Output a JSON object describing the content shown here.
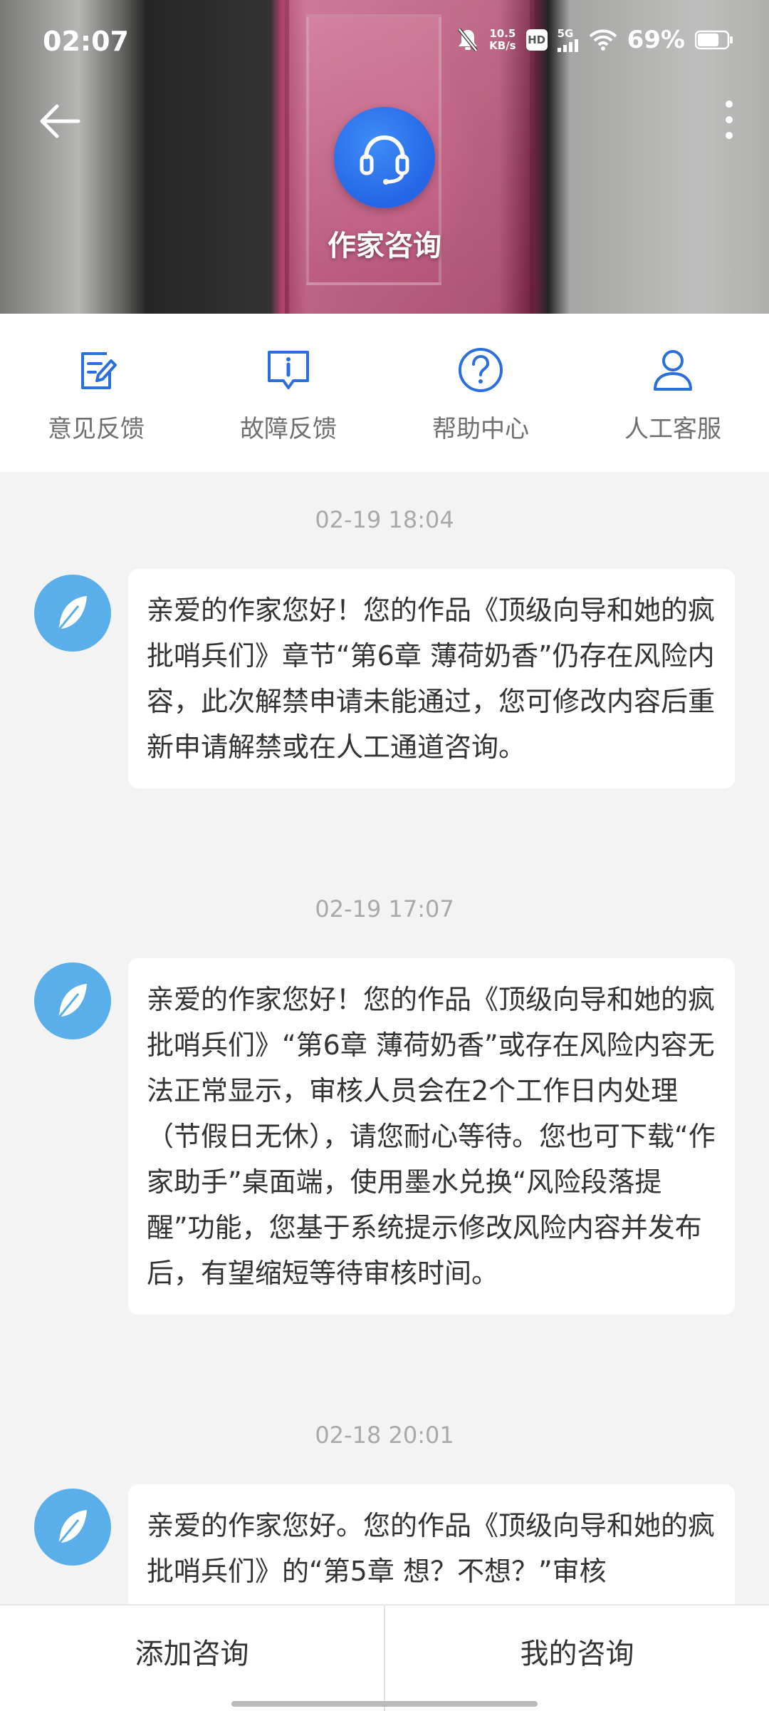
{
  "status_bar": {
    "time": "02:07",
    "net_speed_value": "10.5",
    "net_speed_unit": "KB/s",
    "hd_badge": "HD",
    "network_type": "5G",
    "battery": "69%",
    "icons": [
      "mute-icon",
      "hd-icon",
      "signal-icon",
      "wifi-icon",
      "battery-icon"
    ]
  },
  "header": {
    "title": "作家咨询",
    "logo_icon": "headset-icon",
    "back_icon": "back-arrow-icon",
    "more_icon": "more-vertical-icon",
    "accent_color": "#2466e6"
  },
  "actions": [
    {
      "label": "意见反馈",
      "icon": "feedback-edit-icon"
    },
    {
      "label": "故障反馈",
      "icon": "fault-report-icon"
    },
    {
      "label": "帮助中心",
      "icon": "help-icon"
    },
    {
      "label": "人工客服",
      "icon": "person-icon"
    }
  ],
  "messages": [
    {
      "timestamp": "02-19 18:04",
      "text": "亲爱的作家您好！您的作品《顶级向导和她的疯批哨兵们》章节“第6章 薄荷奶香”仍存在风险内容，此次解禁申请未能通过，您可修改内容后重新申请解禁或在人工通道咨询。"
    },
    {
      "timestamp": "02-19 17:07",
      "text": "亲爱的作家您好！您的作品《顶级向导和她的疯批哨兵们》“第6章 薄荷奶香”或存在风险内容无法正常显示，审核人员会在2个工作日内处理（节假日无休），请您耐心等待。您也可下载“作家助手”桌面端，使用墨水兑换“风险段落提醒”功能，您基于系统提示修改风险内容并发布后，有望缩短等待审核时间。"
    },
    {
      "timestamp": "02-18 20:01",
      "text": "亲爱的作家您好。您的作品《顶级向导和她的疯批哨兵们》的“第5章 想？不想？”审核"
    }
  ],
  "bottom_bar": {
    "add_label": "添加咨询",
    "mine_label": "我的咨询"
  },
  "colors": {
    "avatar_bg": "#5aaeea",
    "icon_blue": "#2a6fdb",
    "timestamp_gray": "#a9a9a9"
  }
}
